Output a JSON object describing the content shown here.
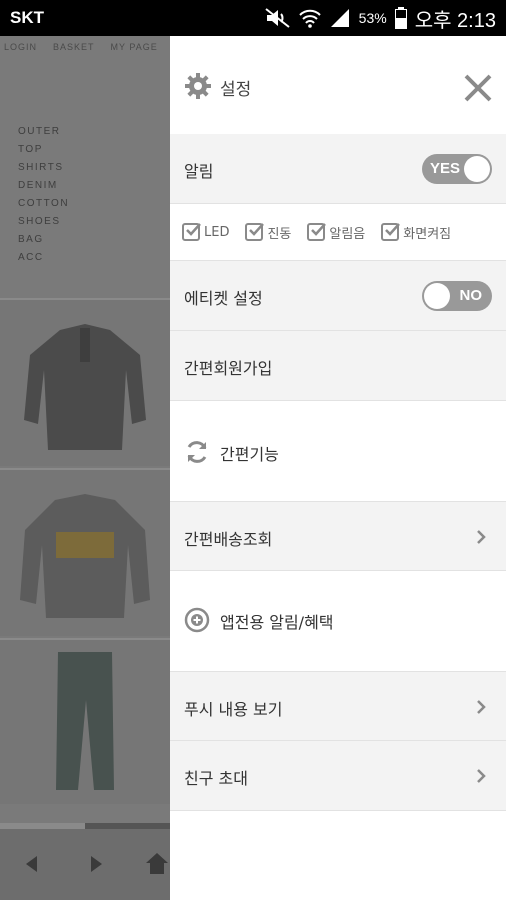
{
  "status_bar": {
    "carrier": "SKT",
    "battery_percent": "53%",
    "time": "오후 2:13"
  },
  "background_app": {
    "top_nav": [
      "LOGIN",
      "BASKET",
      "MY PAGE"
    ],
    "categories": [
      "OUTER",
      "TOP",
      "SHIRTS",
      "DENIM",
      "COTTON",
      "SHOES",
      "BAG",
      "ACC"
    ]
  },
  "drawer": {
    "title": "설정",
    "notification": {
      "label": "알림",
      "toggle_text": "YES"
    },
    "notification_options": [
      "LED",
      "진동",
      "알림음",
      "화면켜짐"
    ],
    "etiquette": {
      "label": "에티켓 설정",
      "toggle_text": "NO"
    },
    "quick_signup": "간편회원가입",
    "quick_features_header": "간편기능",
    "delivery_lookup": "간편배송조회",
    "app_benefits_header": "앱전용 알림/혜택",
    "push_content": "푸시 내용 보기",
    "invite_friends": "친구 초대"
  },
  "icons": {
    "settings": "gear-icon",
    "close": "close-icon",
    "refresh": "refresh-icon",
    "benefit": "plus-circle-icon",
    "chevron": "chevron-right-icon"
  },
  "colors": {
    "drawer_bg": "#ffffff",
    "row_bg": "#f3f3f3",
    "toggle": "#999999",
    "overlay": "#7a7a7a"
  }
}
